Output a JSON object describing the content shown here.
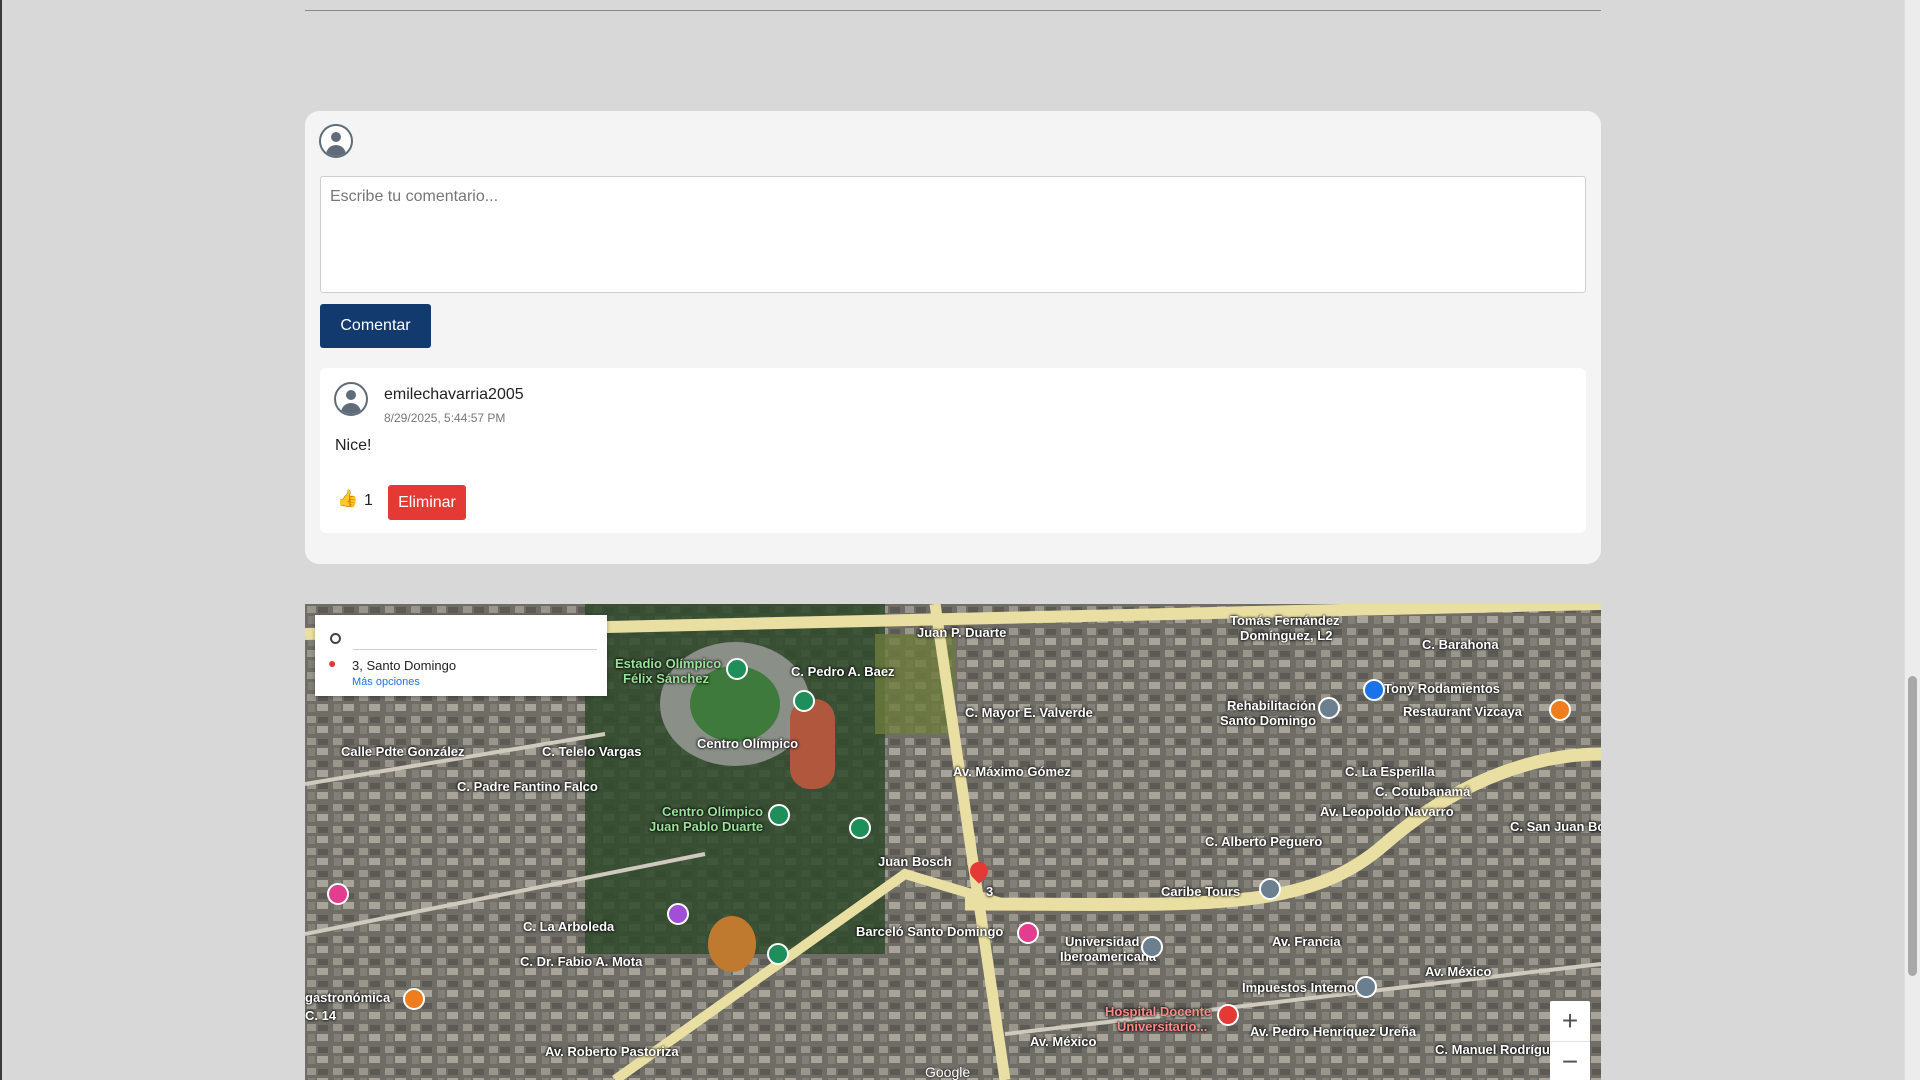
{
  "comment_form": {
    "placeholder": "Escribe tu comentario...",
    "submit_label": "Comentar"
  },
  "comments": [
    {
      "user": "emilechavarria2005",
      "date": "8/29/2025, 5:44:57 PM",
      "text": "Nice!",
      "like_icon": "👍",
      "likes": "1",
      "delete_label": "Eliminar"
    }
  ],
  "map": {
    "destination": "3, Santo Domingo",
    "more_options": "Más opciones",
    "zoom_in": "+",
    "zoom_out": "−",
    "footer": "Google",
    "labels": [
      {
        "text": "Estadio Olímpico",
        "cls": "green"
      },
      {
        "text": "Félix Sánchez",
        "cls": "green"
      },
      {
        "text": "C. Pedro A. Baez",
        "cls": ""
      },
      {
        "text": "Juan P. Duarte",
        "cls": ""
      },
      {
        "text": "C. Mayor E. Valverde",
        "cls": ""
      },
      {
        "text": "Rehabilitación",
        "cls": ""
      },
      {
        "text": "Santo Domingo",
        "cls": ""
      },
      {
        "text": "Tony Rodamientos",
        "cls": ""
      },
      {
        "text": "Restaurant Vizcaya",
        "cls": ""
      },
      {
        "text": "C. Barahona",
        "cls": ""
      },
      {
        "text": "Tomás Fernández",
        "cls": ""
      },
      {
        "text": "Domínguez, L2",
        "cls": ""
      },
      {
        "text": "Calle Pdte González",
        "cls": ""
      },
      {
        "text": "C. Telelo Vargas",
        "cls": ""
      },
      {
        "text": "C. Padre Fantino Falco",
        "cls": ""
      },
      {
        "text": "Centro Olímpico",
        "cls": "green"
      },
      {
        "text": "Juan Pablo Duarte",
        "cls": "green"
      },
      {
        "text": "Centro Olímpico",
        "cls": ""
      },
      {
        "text": "Av. Máximo Gómez",
        "cls": ""
      },
      {
        "text": "Juan Bosch",
        "cls": ""
      },
      {
        "text": "Caribe Tours",
        "cls": ""
      },
      {
        "text": "Barceló Santo Domingo",
        "cls": ""
      },
      {
        "text": "Universidad",
        "cls": ""
      },
      {
        "text": "Iberoamericana",
        "cls": ""
      },
      {
        "text": "Av. Francia",
        "cls": ""
      },
      {
        "text": "Impuestos Internos",
        "cls": ""
      },
      {
        "text": "Av. México",
        "cls": ""
      },
      {
        "text": "Hospital Docente",
        "cls": "red"
      },
      {
        "text": "Universitario...",
        "cls": "red"
      },
      {
        "text": "Av. Pedro Henríquez Ureña",
        "cls": ""
      },
      {
        "text": "C. La Arboleda",
        "cls": ""
      },
      {
        "text": "C. Dr. Fabio A. Mota",
        "cls": ""
      },
      {
        "text": "gastronómica",
        "cls": ""
      },
      {
        "text": "C. 14",
        "cls": ""
      },
      {
        "text": "Av. Roberto Pastoriza",
        "cls": ""
      },
      {
        "text": "C. San Juan Bos",
        "cls": ""
      },
      {
        "text": "C. Cotubanamá",
        "cls": ""
      },
      {
        "text": "C. Alberto Peguero",
        "cls": ""
      },
      {
        "text": "Av. Leopoldo Navarro",
        "cls": ""
      },
      {
        "text": "C. La Esperilla",
        "cls": ""
      },
      {
        "text": "Av. México",
        "cls": ""
      },
      {
        "text": "C. Manuel Rodríguez",
        "cls": ""
      },
      {
        "text": "3",
        "cls": ""
      }
    ]
  }
}
